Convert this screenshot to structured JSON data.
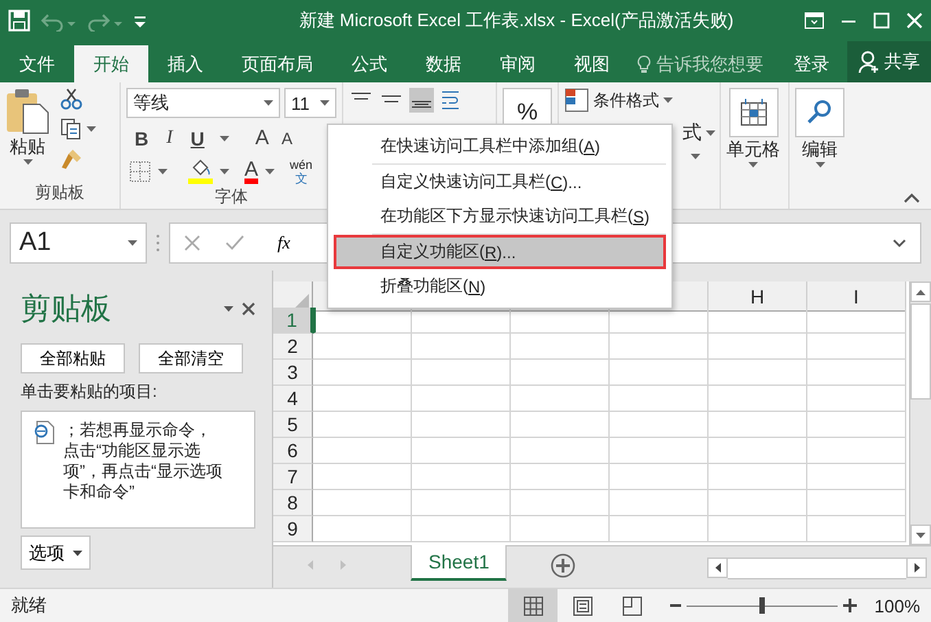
{
  "window": {
    "title": "新建 Microsoft Excel 工作表.xlsx - Excel(产品激活失败)"
  },
  "quick_access": [
    {
      "kind": "save",
      "disabled": false
    },
    {
      "kind": "undo",
      "disabled": true
    },
    {
      "kind": "redo",
      "disabled": true
    },
    {
      "kind": "customize",
      "disabled": false
    }
  ],
  "tabs": [
    {
      "label": "文件",
      "selected": false
    },
    {
      "label": "开始",
      "selected": true
    },
    {
      "label": "插入",
      "selected": false
    },
    {
      "label": "页面布局",
      "selected": false
    },
    {
      "label": "公式",
      "selected": false
    },
    {
      "label": "数据",
      "selected": false
    },
    {
      "label": "审阅",
      "selected": false
    },
    {
      "label": "视图",
      "selected": false
    }
  ],
  "tell_me": {
    "placeholder": "告诉我您想要"
  },
  "sign_in": "登录",
  "share": "共享",
  "ribbon": {
    "paste": "粘贴",
    "clipboard_group": "剪贴板",
    "font_name": "等线",
    "font_size": "11",
    "bold": "B",
    "italic": "I",
    "underline": "U",
    "grow_font": "A",
    "shrink_font": "A",
    "font_color": "A",
    "phonetic_top": "wén",
    "phonetic_bottom": "文",
    "font_group": "字体",
    "percent": "%",
    "conditional_format": "条件格式",
    "table_format_cut": "式",
    "cells": "单元格",
    "editing": "编辑"
  },
  "name_box": "A1",
  "fx": "fx",
  "context_menu": [
    {
      "text": "在快速访问工具栏中添加组(",
      "key": "A",
      "tail": ")",
      "selected": false,
      "annotated": false,
      "separator_after": true
    },
    {
      "text": "自定义快速访问工具栏(",
      "key": "C",
      "tail": ")...",
      "selected": false,
      "annotated": false,
      "separator_after": false
    },
    {
      "text": "在功能区下方显示快速访问工具栏(",
      "key": "S",
      "tail": ")",
      "selected": false,
      "annotated": false,
      "separator_after": true
    },
    {
      "text": "自定义功能区(",
      "key": "R",
      "tail": ")...",
      "selected": true,
      "annotated": true,
      "separator_after": false
    },
    {
      "text": "折叠功能区(",
      "key": "N",
      "tail": ")",
      "selected": false,
      "annotated": false,
      "separator_after": false
    }
  ],
  "task_pane": {
    "title": "剪贴板",
    "buttons": [
      "全部粘贴",
      "全部清空"
    ],
    "prompt": "单击要粘贴的项目:",
    "clip_text": "；若想再显示命令，点击“功能区显示选项”，再点击“显示选项卡和命令”",
    "options": "选项"
  },
  "grid": {
    "visible_column_headers": [
      "H",
      "I"
    ],
    "rows": [
      {
        "label": "1",
        "selected": true
      },
      {
        "label": "2",
        "selected": false
      },
      {
        "label": "3",
        "selected": false
      },
      {
        "label": "4",
        "selected": false
      },
      {
        "label": "5",
        "selected": false
      },
      {
        "label": "6",
        "selected": false
      },
      {
        "label": "7",
        "selected": false
      },
      {
        "label": "8",
        "selected": false
      },
      {
        "label": "9",
        "selected": false
      }
    ]
  },
  "sheet_tabs": [
    {
      "label": "Sheet1",
      "selected": true
    }
  ],
  "status_bar": {
    "text": "就绪",
    "views": [
      {
        "kind": "normal",
        "selected": true
      },
      {
        "kind": "page_layout",
        "selected": false
      },
      {
        "kind": "page_break",
        "selected": false
      }
    ],
    "zoom": {
      "level": 0.5
    },
    "zoom_text": "100%"
  }
}
